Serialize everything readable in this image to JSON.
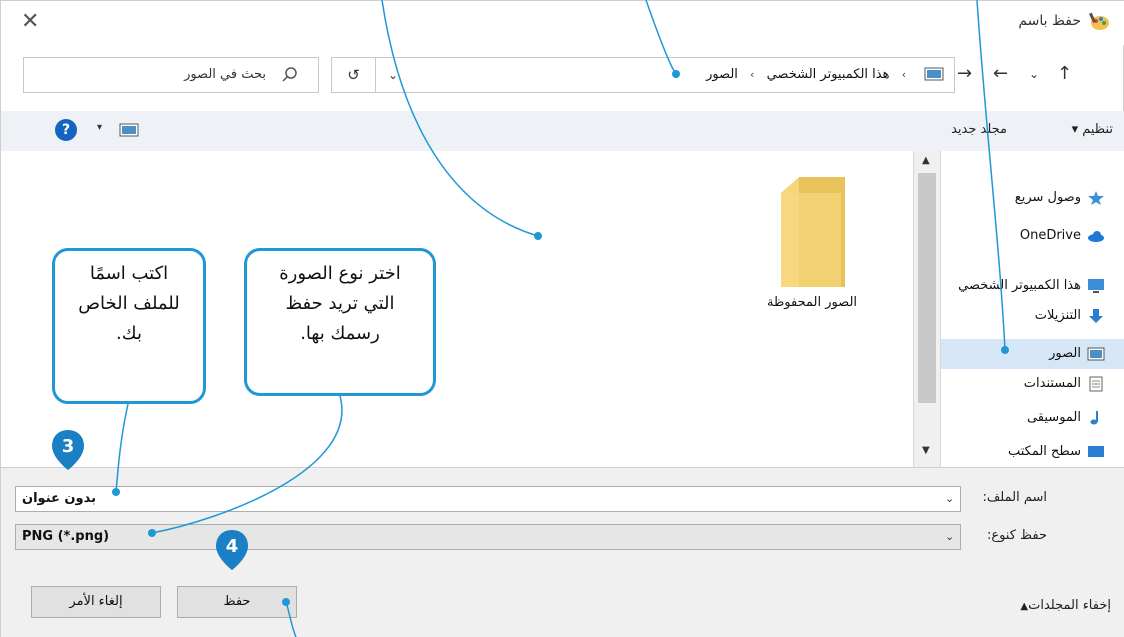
{
  "window": {
    "title": "حفظ باسم",
    "close_glyph": "✕"
  },
  "nav": {
    "search_placeholder": "بحث في الصور",
    "breadcrumb": [
      "هذا الكمبيوتر الشخصي",
      "الصور"
    ],
    "breadcrumb_sep": "›",
    "refresh_glyph": "↺",
    "dropdown_glyph": "⌄"
  },
  "toolbar": {
    "organize_label": "تنظيم ▾",
    "new_folder_label": "مجلد جديد",
    "help_label": "?",
    "view_dropdown": "▾"
  },
  "content": {
    "items": [
      {
        "label": "الصور المحفوظة",
        "icon": "folder-icon"
      }
    ]
  },
  "nav_pane": {
    "items": [
      {
        "label": "وصول سريع",
        "icon": "star-icon"
      },
      {
        "label": "OneDrive",
        "icon": "cloud-icon"
      },
      {
        "label": "هذا الكمبيوتر الشخصي",
        "icon": "computer-icon"
      },
      {
        "label": "التنزيلات",
        "icon": "download-icon"
      },
      {
        "label": "الصور",
        "icon": "pictures-icon",
        "selected": true
      },
      {
        "label": "المستندات",
        "icon": "documents-icon"
      },
      {
        "label": "الموسيقى",
        "icon": "music-icon"
      },
      {
        "label": "سطح المكتب",
        "icon": "desktop-icon"
      }
    ]
  },
  "form": {
    "filename_label": "اسم الملف:",
    "filename_value": "بدون عنوان",
    "filetype_label": "حفظ كنوع:",
    "filetype_value": "PNG (*.png)",
    "save_button": "حفظ",
    "cancel_button": "إلغاء الأمر",
    "hide_folders": "إخفاء المجلدات"
  },
  "callouts": {
    "name_hint": "اكتب اسمًا للملف الخاص بك.",
    "type_hint": "اختر نوع الصورة التي تريد حفظ رسمك بها."
  },
  "badges": {
    "step3": "3",
    "step4": "4"
  },
  "colors": {
    "accent": "#1f98d5",
    "badge": "#1a7fc4",
    "selection": "#d5e6f7",
    "toolbar_bg": "#eef2f7",
    "form_bg": "#f0f0f0"
  }
}
